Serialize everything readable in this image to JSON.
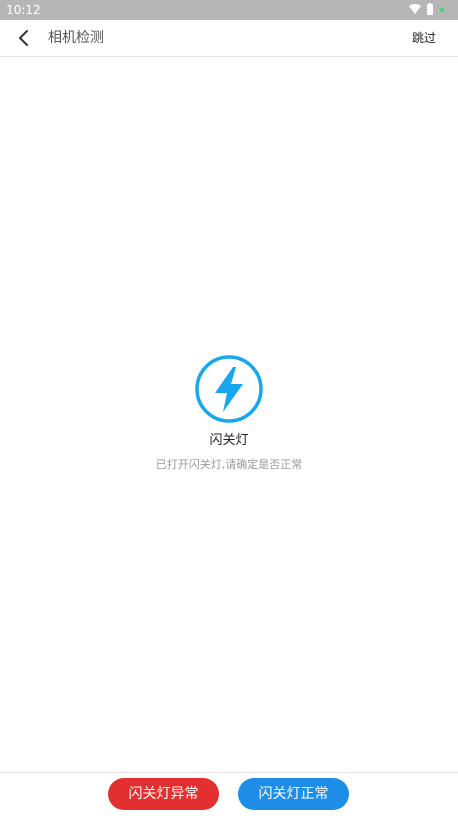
{
  "status_bar": {
    "time": "10:12",
    "icons": [
      "wifi-icon",
      "battery-icon",
      "notification-dot-icon"
    ]
  },
  "header": {
    "back_icon": "chevron-left-icon",
    "title": "相机检测",
    "skip_label": "跳过"
  },
  "content": {
    "icon": "lightning-bolt-icon",
    "title": "闪关灯",
    "description": "已打开闪关灯,请确定是否正常"
  },
  "footer": {
    "abnormal_label": "闪关灯异常",
    "normal_label": "闪关灯正常"
  },
  "colors": {
    "accent_blue": "#1e8de8",
    "icon_cyan": "#16a7ee",
    "danger_red": "#e32f2f",
    "status_bar_gray": "#b6b6b6"
  }
}
